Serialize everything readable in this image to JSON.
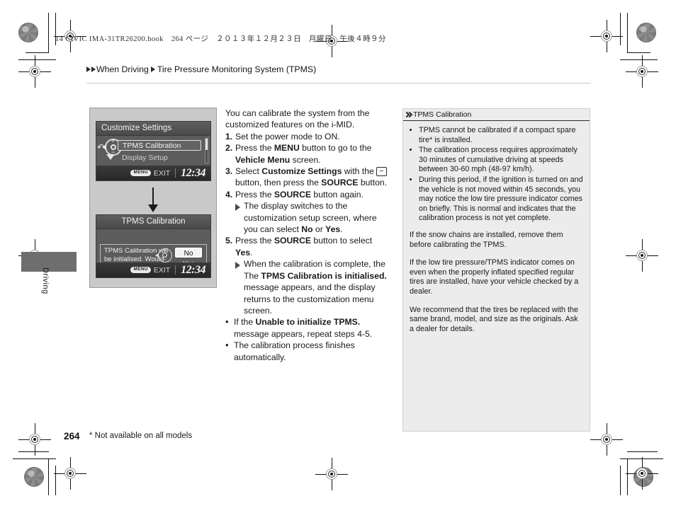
{
  "book_meta": "14 CIVIC IMA-31TR26200.book　264 ページ　２０１３年１２月２３日　月曜日　午後４時９分",
  "breadcrumb": {
    "section": "When Driving",
    "topic": "Tire Pressure Monitoring System (TPMS)"
  },
  "margin_tab": {
    "label": "Driving"
  },
  "illustration": {
    "screen1": {
      "title": "Customize Settings",
      "selected_item": "TPMS Calibration",
      "next_item": "Display Setup",
      "footer_button": "MENU",
      "footer_label": "EXIT",
      "clock": "12:34"
    },
    "screen2": {
      "title": "TPMS Calibration",
      "message": "TPMS Calibration will be initialised. Would you like to proceed?",
      "button_no": "No",
      "button_yes": "Yes",
      "footer_button": "MENU",
      "footer_label": "EXIT",
      "clock": "12:34"
    }
  },
  "main": {
    "intro": "You can calibrate the system from the customized features on the i-MID.",
    "steps": [
      {
        "num": "1.",
        "text": "Set the power mode to ON."
      },
      {
        "num": "2.",
        "text_1": "Press the ",
        "bold_1": "MENU",
        "text_2": " button to go to the ",
        "bold_2": "Vehicle Menu",
        "text_3": " screen."
      },
      {
        "num": "3.",
        "text_1": "Select ",
        "bold_1": "Customize Settings",
        "text_2": " with the ",
        "key": "−",
        "text_3": " button, then press the ",
        "bold_2": "SOURCE",
        "text_4": " button."
      },
      {
        "num": "4.",
        "text_1": "Press the ",
        "bold_1": "SOURCE",
        "text_2": " button again."
      }
    ],
    "sub_4": "The display switches to the customization setup screen, where you can select ",
    "sub_4_bold_a": "No",
    "sub_4_mid": " or ",
    "sub_4_bold_b": "Yes",
    "sub_4_end": ".",
    "step5": {
      "num": "5.",
      "text_1": "Press the ",
      "bold_1": "SOURCE",
      "text_2": " button to select ",
      "bold_2": "Yes",
      "text_3": "."
    },
    "sub_5_a": "When the calibration is complete, the The ",
    "sub_5_bold": "TPMS Calibration is initialised.",
    "sub_5_b": " message appears, and the display returns to the customization menu screen.",
    "bullets": [
      {
        "text_1": "If the ",
        "bold": "Unable to initialize TPMS.",
        "text_2": " message appears, repeat steps 4-5."
      },
      {
        "text_1": "The calibration process finishes automatically.",
        "bold": "",
        "text_2": ""
      }
    ]
  },
  "sidebar": {
    "title": "TPMS Calibration",
    "bullets": [
      "TPMS cannot be calibrated if a compact spare tire* is installed.",
      "The calibration process requires approximately 30 minutes of cumulative driving at speeds between 30-60 mph (48-97 km/h).",
      "During this period, if the ignition is turned on and the vehicle is not moved within 45 seconds, you may notice the low tire pressure indicator comes on briefly. This is normal and indicates that the calibration process is not yet complete."
    ],
    "paragraphs": [
      "If the snow chains are installed, remove them before calibrating the TPMS.",
      "If the low tire pressure/TPMS indicator comes on even when the properly inflated specified regular tires are installed, have your vehicle checked by a dealer.",
      "We recommend that the tires be replaced with the same brand, model, and size as the originals. Ask a dealer for details."
    ]
  },
  "footer": {
    "page_number": "264",
    "footnote": "* Not available on all models"
  }
}
